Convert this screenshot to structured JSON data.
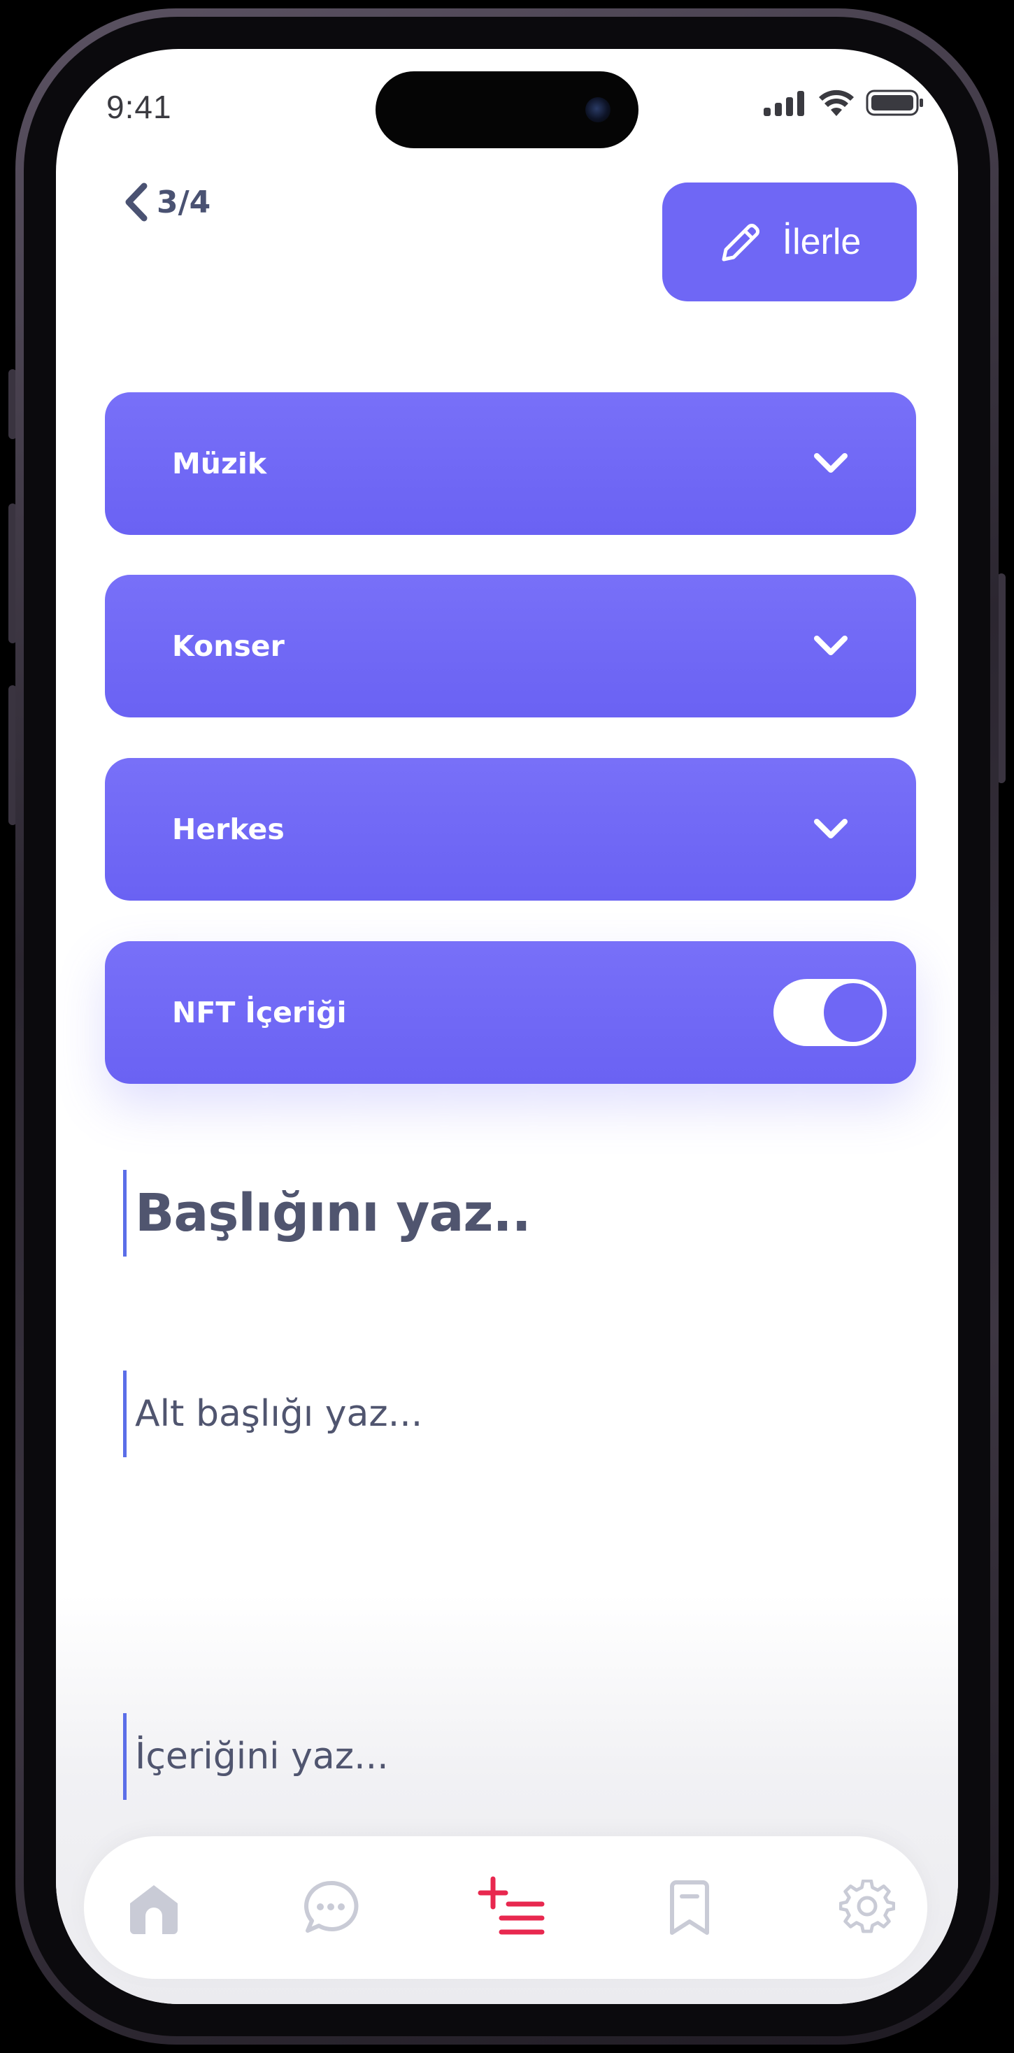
{
  "status_bar": {
    "time": "9:41"
  },
  "header": {
    "step": "3/4",
    "next_label": "İlerle"
  },
  "selects": [
    {
      "label": "Müzik"
    },
    {
      "label": "Konser"
    },
    {
      "label": "Herkes"
    }
  ],
  "nft_toggle": {
    "label": "NFT İçeriği",
    "checked": true
  },
  "fields": {
    "title_placeholder": "Başlığını yaz..",
    "subtitle_placeholder": "Alt başlığı yaz...",
    "content_placeholder": "İçeriğini yaz..."
  },
  "tab_bar": {
    "items": [
      {
        "icon": "home-icon"
      },
      {
        "icon": "chat-icon"
      },
      {
        "icon": "create-post-icon",
        "active": true
      },
      {
        "icon": "bookmark-icon"
      },
      {
        "icon": "settings-icon"
      }
    ]
  },
  "colors": {
    "accent": "#6f67f5",
    "active_tab": "#e8284f",
    "inactive_tab": "#c9cbd6",
    "text": "#50556f"
  }
}
